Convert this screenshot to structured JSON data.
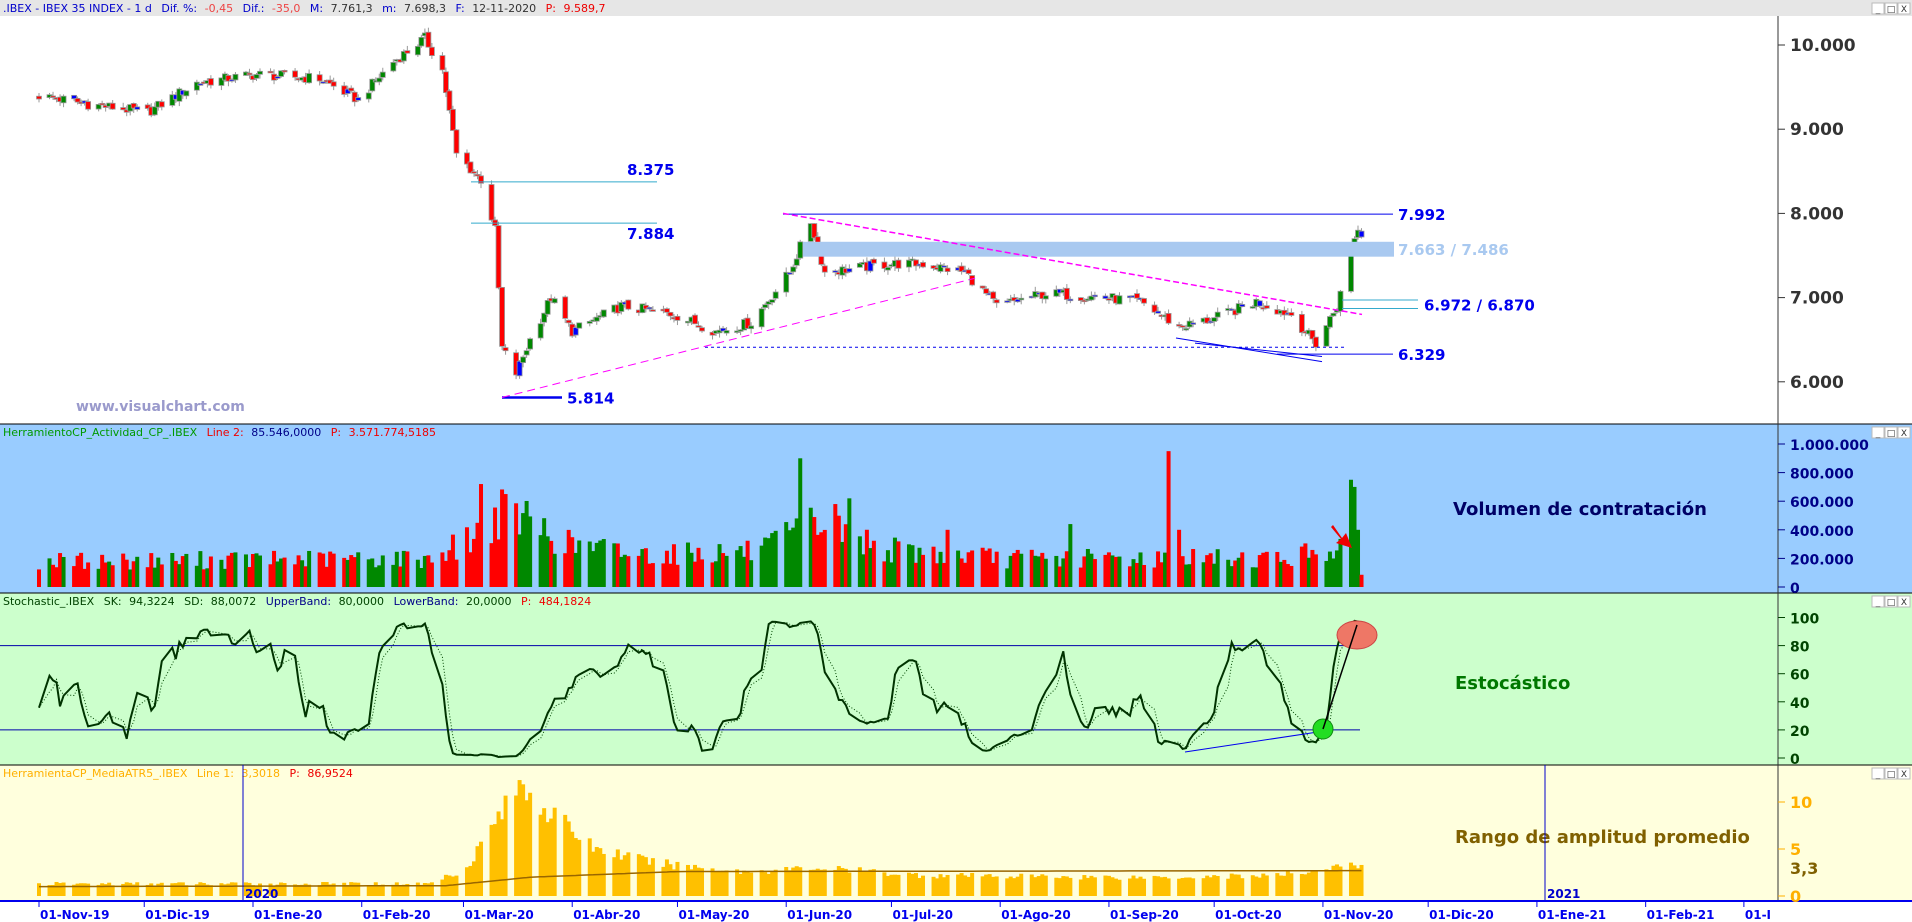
{
  "header": {
    "symbol": ".IBEX - IBEX 35 INDEX -  1 d",
    "dif_pct_label": "Dif. %:",
    "dif_pct": "-0,45",
    "dif_label": "Dif.:",
    "dif": "-35,0",
    "max_label": "M:",
    "max": "7.761,3",
    "min_label": "m:",
    "min": "7.698,3",
    "date_label": "F:",
    "date": "12-11-2020",
    "p_label": "P:",
    "p": "9.589,7"
  },
  "watermark": "www.visualchart.com",
  "window_buttons": {
    "minimize": "_",
    "maximize": "□",
    "close": "X"
  },
  "panels": {
    "volume": {
      "name": "HerramientoCP_Actividad_CP_.IBEX",
      "line_label": "Line 2:",
      "line_value": "85.546,0000",
      "p_label": "P:",
      "p_value": "3.571.774,5185",
      "title": "Volumen de contratación"
    },
    "stochastic": {
      "name": "Stochastic_.IBEX",
      "sk_label": "SK:",
      "sk": "94,3224",
      "sd_label": "SD:",
      "sd": "88,0072",
      "upper_label": "UpperBand:",
      "upper": "80,0000",
      "lower_label": "LowerBand:",
      "lower": "20,0000",
      "p_label": "P:",
      "p_value": "484,1824",
      "title": "Estocástico"
    },
    "atr": {
      "name": "HerramientaCP_MediaATR5_.IBEX",
      "line_label": "Line 1:",
      "line_value": "3,3018",
      "p_label": "P:",
      "p_value": "86,9524",
      "title": "Rango de amplitud promedio",
      "current_label": "3,3"
    }
  },
  "annotations": {
    "level_8375": "8.375",
    "level_7884": "7.884",
    "level_5814": "5.814",
    "level_7992": "7.992",
    "zone": "7.663 / 7.486",
    "gap": "6.972 / 6.870",
    "level_6329": "6.329",
    "year_2020": "2020",
    "year_2021": "2021"
  },
  "colors": {
    "up": "#008800",
    "down": "#ff0000",
    "inside": "#0000ff",
    "volume_bg": "#99ccff",
    "stoch_bg": "#ccffcc",
    "atr_bg": "#ffffdd",
    "atr_bar": "#ffc000",
    "trend": "#ff00ff",
    "level": "#0000ff",
    "zone": "#a9c9f0"
  },
  "chart_data": [
    {
      "type": "candlestick",
      "title": "IBEX 35 INDEX - 1 d",
      "yticks": [
        "10.000",
        "9.000",
        "8.000",
        "7.000",
        "6.000"
      ],
      "ytick_values": [
        10000,
        9000,
        8000,
        7000,
        6000
      ],
      "ylim": [
        5400,
        10400
      ],
      "x_start": "2019-11-01",
      "x_end": "2020-11-12",
      "xtick_labels": [
        "01-Nov-19",
        "01-Dic-19",
        "01-Ene-20",
        "01-Feb-20",
        "01-Mar-20",
        "01-Abr-20",
        "01-May-20",
        "01-Jun-20",
        "01-Jul-20",
        "01-Ago-20",
        "01-Sep-20",
        "01-Oct-20",
        "01-Nov-20",
        "01-Dic-20",
        "01-Ene-21",
        "01-Feb-21",
        "01-I"
      ],
      "xtick_dates": [
        "2019-11-01",
        "2019-12-01",
        "2020-01-01",
        "2020-02-01",
        "2020-03-01",
        "2020-04-01",
        "2020-05-01",
        "2020-06-01",
        "2020-07-01",
        "2020-08-01",
        "2020-09-01",
        "2020-10-01",
        "2020-11-01",
        "2020-12-01",
        "2021-01-01",
        "2021-02-01",
        "2021-03-01"
      ],
      "close_keypoints": [
        [
          "2019-11-01",
          9400
        ],
        [
          "2019-11-15",
          9300
        ],
        [
          "2019-12-02",
          9200
        ],
        [
          "2019-12-16",
          9550
        ],
        [
          "2020-01-02",
          9650
        ],
        [
          "2020-01-20",
          9600
        ],
        [
          "2020-01-31",
          9350
        ],
        [
          "2020-02-10",
          9800
        ],
        [
          "2020-02-19",
          10080
        ],
        [
          "2020-02-24",
          9700
        ],
        [
          "2020-02-28",
          8700
        ],
        [
          "2020-03-06",
          8400
        ],
        [
          "2020-03-10",
          7800
        ],
        [
          "2020-03-12",
          6400
        ],
        [
          "2020-03-16",
          6100
        ],
        [
          "2020-03-20",
          6500
        ],
        [
          "2020-03-26",
          7000
        ],
        [
          "2020-04-01",
          6600
        ],
        [
          "2020-04-15",
          6900
        ],
        [
          "2020-04-30",
          6800
        ],
        [
          "2020-05-12",
          6600
        ],
        [
          "2020-05-22",
          6700
        ],
        [
          "2020-06-02",
          7300
        ],
        [
          "2020-06-08",
          7900
        ],
        [
          "2020-06-12",
          7300
        ],
        [
          "2020-06-30",
          7400
        ],
        [
          "2020-07-10",
          7400
        ],
        [
          "2020-07-22",
          7300
        ],
        [
          "2020-07-31",
          6900
        ],
        [
          "2020-08-14",
          7050
        ],
        [
          "2020-08-31",
          7000
        ],
        [
          "2020-09-10",
          6950
        ],
        [
          "2020-09-21",
          6650
        ],
        [
          "2020-10-01",
          6750
        ],
        [
          "2020-10-13",
          6950
        ],
        [
          "2020-10-23",
          6800
        ],
        [
          "2020-10-30",
          6450
        ],
        [
          "2020-11-05",
          6900
        ],
        [
          "2020-11-09",
          7600
        ],
        [
          "2020-11-11",
          7800
        ],
        [
          "2020-11-12",
          7720
        ]
      ],
      "levels": [
        8375,
        7884,
        5814,
        7992,
        [
          7663,
          7486
        ],
        [
          6972,
          6870
        ],
        6329
      ]
    },
    {
      "type": "bar",
      "title": "Volumen de contratación",
      "yticks": [
        "1.000.000",
        "800.000",
        "600.000",
        "400.000",
        "200.000",
        "0"
      ],
      "ytick_values": [
        1000000,
        800000,
        600000,
        400000,
        200000,
        0
      ],
      "ylim": [
        0,
        1000000
      ],
      "base_keypoints": [
        [
          "2019-11-01",
          180000
        ],
        [
          "2020-02-20",
          200000
        ],
        [
          "2020-03-02",
          320000
        ],
        [
          "2020-03-13",
          550000
        ],
        [
          "2020-03-31",
          300000
        ],
        [
          "2020-04-20",
          230000
        ],
        [
          "2020-05-25",
          250000
        ],
        [
          "2020-06-10",
          450000
        ],
        [
          "2020-06-30",
          260000
        ],
        [
          "2020-08-01",
          200000
        ],
        [
          "2020-10-20",
          200000
        ],
        [
          "2020-11-06",
          280000
        ]
      ],
      "spikes": [
        [
          "2020-03-06",
          720000
        ],
        [
          "2020-03-13",
          650000
        ],
        [
          "2020-06-05",
          900000
        ],
        [
          "2020-06-15",
          580000
        ],
        [
          "2020-06-19",
          620000
        ],
        [
          "2020-07-17",
          400000
        ],
        [
          "2020-09-18",
          950000
        ],
        [
          "2020-09-21",
          400000
        ],
        [
          "2020-08-21",
          440000
        ],
        [
          "2020-11-09",
          750000
        ],
        [
          "2020-11-10",
          700000
        ],
        [
          "2020-11-11",
          400000
        ],
        [
          "2020-11-12",
          85546
        ]
      ]
    },
    {
      "type": "line",
      "title": "Estocástico",
      "series": [
        {
          "name": "SK",
          "last": 94.3224
        },
        {
          "name": "SD",
          "last": 88.0072
        }
      ],
      "bands": {
        "upper": 80,
        "lower": 20
      },
      "yticks": [
        "100",
        "80",
        "60",
        "40",
        "20",
        "0"
      ],
      "ytick_values": [
        100,
        80,
        60,
        40,
        20,
        0
      ],
      "ylim": [
        0,
        100
      ]
    },
    {
      "type": "bar",
      "title": "Rango de amplitud promedio",
      "yticks": [
        "10",
        "5",
        "0"
      ],
      "ytick_values": [
        10,
        5,
        0
      ],
      "ylim": [
        0,
        11
      ],
      "atr_keypoints": [
        [
          "2019-11-01",
          1.3
        ],
        [
          "2020-02-20",
          1.3
        ],
        [
          "2020-03-02",
          3
        ],
        [
          "2020-03-10",
          8
        ],
        [
          "2020-03-18",
          12
        ],
        [
          "2020-03-25",
          9
        ],
        [
          "2020-04-08",
          5
        ],
        [
          "2020-04-25",
          3.5
        ],
        [
          "2020-05-20",
          2.6
        ],
        [
          "2020-06-10",
          3
        ],
        [
          "2020-07-10",
          2.2
        ],
        [
          "2020-09-10",
          2
        ],
        [
          "2020-10-20",
          2.2
        ],
        [
          "2020-11-04",
          3
        ],
        [
          "2020-11-12",
          3.3
        ]
      ],
      "avg_keypoints": [
        [
          "2019-11-01",
          1.0
        ],
        [
          "2020-02-25",
          1.1
        ],
        [
          "2020-03-20",
          2.0
        ],
        [
          "2020-05-01",
          2.6
        ],
        [
          "2020-11-12",
          2.7
        ]
      ],
      "last": 3.3018
    }
  ]
}
